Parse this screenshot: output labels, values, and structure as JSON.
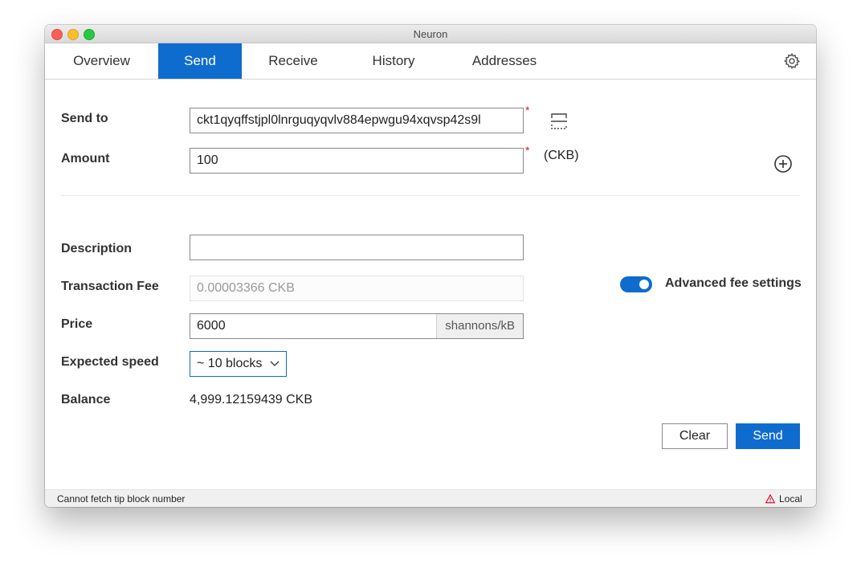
{
  "window": {
    "title": "Neuron"
  },
  "tabs": [
    {
      "label": "Overview",
      "active": false
    },
    {
      "label": "Send",
      "active": true
    },
    {
      "label": "Receive",
      "active": false
    },
    {
      "label": "History",
      "active": false
    },
    {
      "label": "Addresses",
      "active": false
    }
  ],
  "form": {
    "send_to": {
      "label": "Send to",
      "value": "ckt1qyqffstjpl0lnrguqyqvlv884epwgu94xqvsp42s9l",
      "required_mark": "*"
    },
    "amount": {
      "label": "Amount",
      "value": "100",
      "required_mark": "*",
      "unit": "(CKB)"
    },
    "description": {
      "label": "Description",
      "value": ""
    },
    "transaction_fee": {
      "label": "Transaction Fee",
      "value": "0.00003366 CKB"
    },
    "advanced_fee": {
      "label": "Advanced fee settings",
      "enabled": true
    },
    "price": {
      "label": "Price",
      "value": "6000",
      "unit": "shannons/kB"
    },
    "expected_speed": {
      "label": "Expected speed",
      "selected": "~ 10 blocks"
    },
    "balance": {
      "label": "Balance",
      "value": "4,999.12159439 CKB"
    }
  },
  "actions": {
    "clear_label": "Clear",
    "send_label": "Send"
  },
  "status": {
    "message": "Cannot fetch tip block number",
    "network": "Local"
  },
  "icons": {
    "settings": "gear-icon",
    "scan": "scan-qr-icon",
    "add": "plus-circle-icon",
    "select": "chevron-down-icon",
    "warning": "warning-triangle-icon"
  },
  "colors": {
    "accent": "#0f6ccf",
    "required": "#c0262b",
    "warning": "#d0021b"
  }
}
